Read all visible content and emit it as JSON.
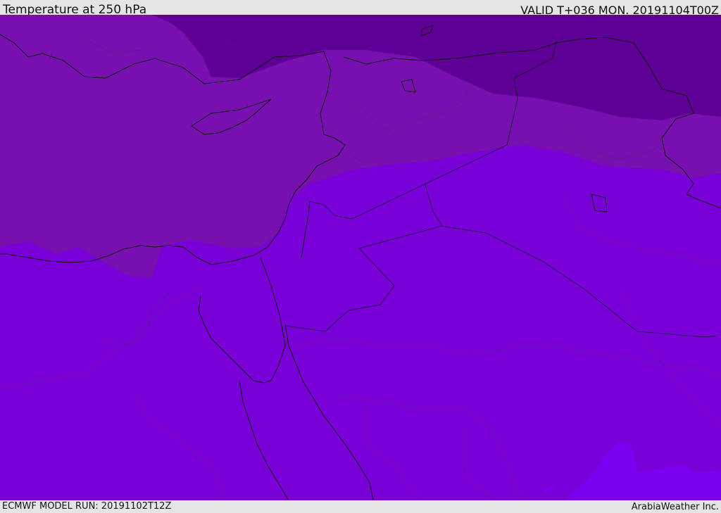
{
  "header": {
    "title": "Temperature at 250 hPa",
    "valid": "VALID T+036 MON. 20191104T00Z"
  },
  "footer": {
    "model_run": "ECMWF MODEL RUN: 20191102T12Z",
    "credit": "ArabiaWeather Inc."
  },
  "map": {
    "colors": {
      "coldest": "#5e0096",
      "cold": "#7810b0",
      "mid": "#7a00d8",
      "warm": "#7a00f0",
      "coast": "#111111",
      "border": "#2a2a40"
    }
  }
}
